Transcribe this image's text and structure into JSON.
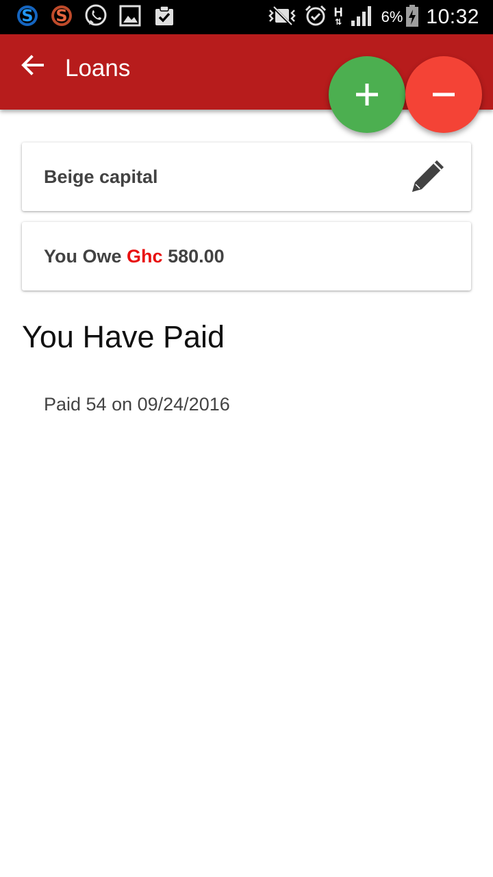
{
  "status_bar": {
    "battery_percent": "6%",
    "time": "10:32",
    "network_type": "H",
    "icons": [
      "skype-icon",
      "skype-alt-icon",
      "whatsapp-icon",
      "gallery-icon",
      "clipboard-check-icon",
      "mute-icon",
      "alarm-icon",
      "signal-icon",
      "battery-icon"
    ]
  },
  "app_bar": {
    "title": "Loans",
    "color": "#b71c1c"
  },
  "fab": {
    "add_color": "#4caf50",
    "remove_color": "#f44336"
  },
  "loan": {
    "name": "Beige capital",
    "owe_prefix": "You Owe",
    "currency": "Ghc",
    "amount": "580.00"
  },
  "payments": {
    "heading": "You Have Paid",
    "items": [
      "Paid 54 on 09/24/2016"
    ]
  }
}
